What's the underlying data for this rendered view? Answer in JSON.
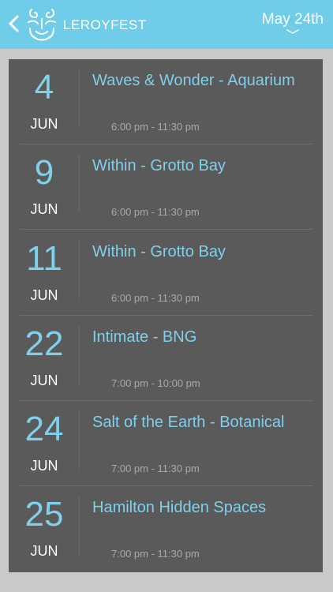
{
  "header": {
    "brand": "LEROYFEST",
    "date_label": "May 24th",
    "back_icon": "chevron-left-icon",
    "logo_icon": "lion-face-logo",
    "date_picker_icon": "chevron-down-icon",
    "accent_color": "#6fcdea"
  },
  "events": [
    {
      "day": "4",
      "month": "JUN",
      "title": "Waves & Wonder - Aquarium",
      "time": "6:00 pm - 11:30 pm"
    },
    {
      "day": "9",
      "month": "JUN",
      "title": "Within - Grotto Bay",
      "time": "6:00 pm - 11:30 pm"
    },
    {
      "day": "11",
      "month": "JUN",
      "title": "Within - Grotto Bay",
      "time": "6:00 pm - 11:30 pm"
    },
    {
      "day": "22",
      "month": "JUN",
      "title": "Intimate - BNG",
      "time": "7:00 pm - 10:00 pm"
    },
    {
      "day": "24",
      "month": "JUN",
      "title": "Salt of the Earth - Botanical",
      "time": "7:00 pm - 11:30 pm"
    },
    {
      "day": "25",
      "month": "JUN",
      "title": "Hamilton Hidden Spaces",
      "time": "7:00 pm - 11:30 pm"
    }
  ]
}
